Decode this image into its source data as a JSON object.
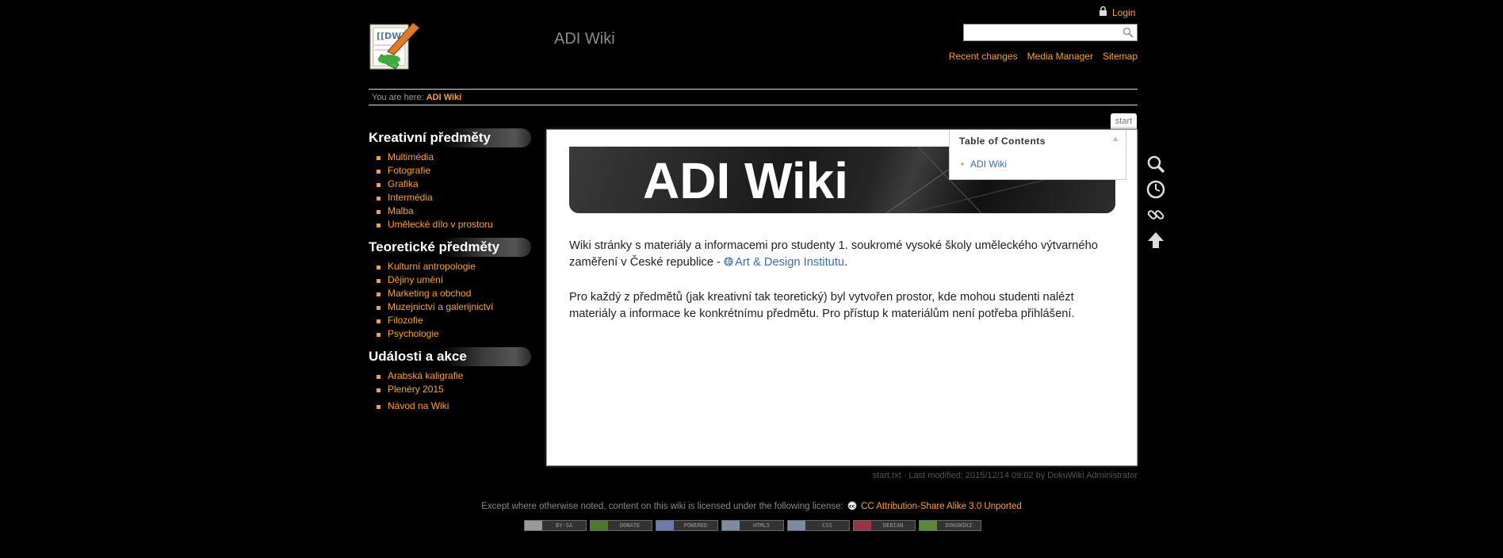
{
  "header": {
    "site_title": "ADI Wiki",
    "login_label": "Login",
    "search_placeholder": "",
    "links": [
      "Recent changes",
      "Media Manager",
      "Sitemap"
    ]
  },
  "breadcrumb": {
    "prefix": "You are here:",
    "current": "ADI Wiki"
  },
  "sidebar": {
    "sections": [
      {
        "title": "Kreativní předměty",
        "items": [
          "Multimédia",
          "Fotografie",
          "Grafika",
          "Intermédia",
          "Malba",
          "Umělecké dílo v prostoru"
        ]
      },
      {
        "title": "Teoretické předměty",
        "items": [
          "Kulturní antropologie",
          "Dějiny umění",
          "Marketing a obchod",
          "Muzejnictví a galerijnictví",
          "Filozofie",
          "Psychologie"
        ]
      },
      {
        "title": "Události a akce",
        "items": [
          "Arabská kaligrafie",
          "Plenéry 2015"
        ]
      }
    ],
    "extra_item": "Návod na Wiki"
  },
  "page_tab": "start",
  "content": {
    "banner_text": "ADI Wiki",
    "toc": {
      "title": "Table of Contents",
      "items": [
        "ADI Wiki"
      ]
    },
    "p1_text": "Wiki stránky s materiály a informacemi pro studenty 1. soukromé vysoké školy uměleckého výtvarného zaměření v České republice - ",
    "p1_link": "Art & Design Institutu",
    "p1_end": ".",
    "p2_text": "Pro každý z předmětů (jak kreativní tak teoretický) byl vytvořen prostor, kde mohou studenti nalézt materiály a informace ke konkrétnímu předmětu. Pro přístup k materiálům není potřeba přihlášení."
  },
  "docinfo": "start.txt · Last modified: 2015/12/14 09:02 by DokuWiki Administrator",
  "footer": {
    "license_text": "Except where otherwise noted, content on this wiki is licensed under the following license:",
    "license_link": "CC Attribution-Share Alike 3.0 Unported",
    "badges": [
      "BY-SA",
      "DONATE",
      "POWERED",
      "HTML5",
      "CSS",
      "DEBIAN",
      "DOKUWIKI"
    ]
  },
  "colors": {
    "accent": "#f7a23d",
    "link": "#3e6fa6",
    "background": "#000000"
  }
}
